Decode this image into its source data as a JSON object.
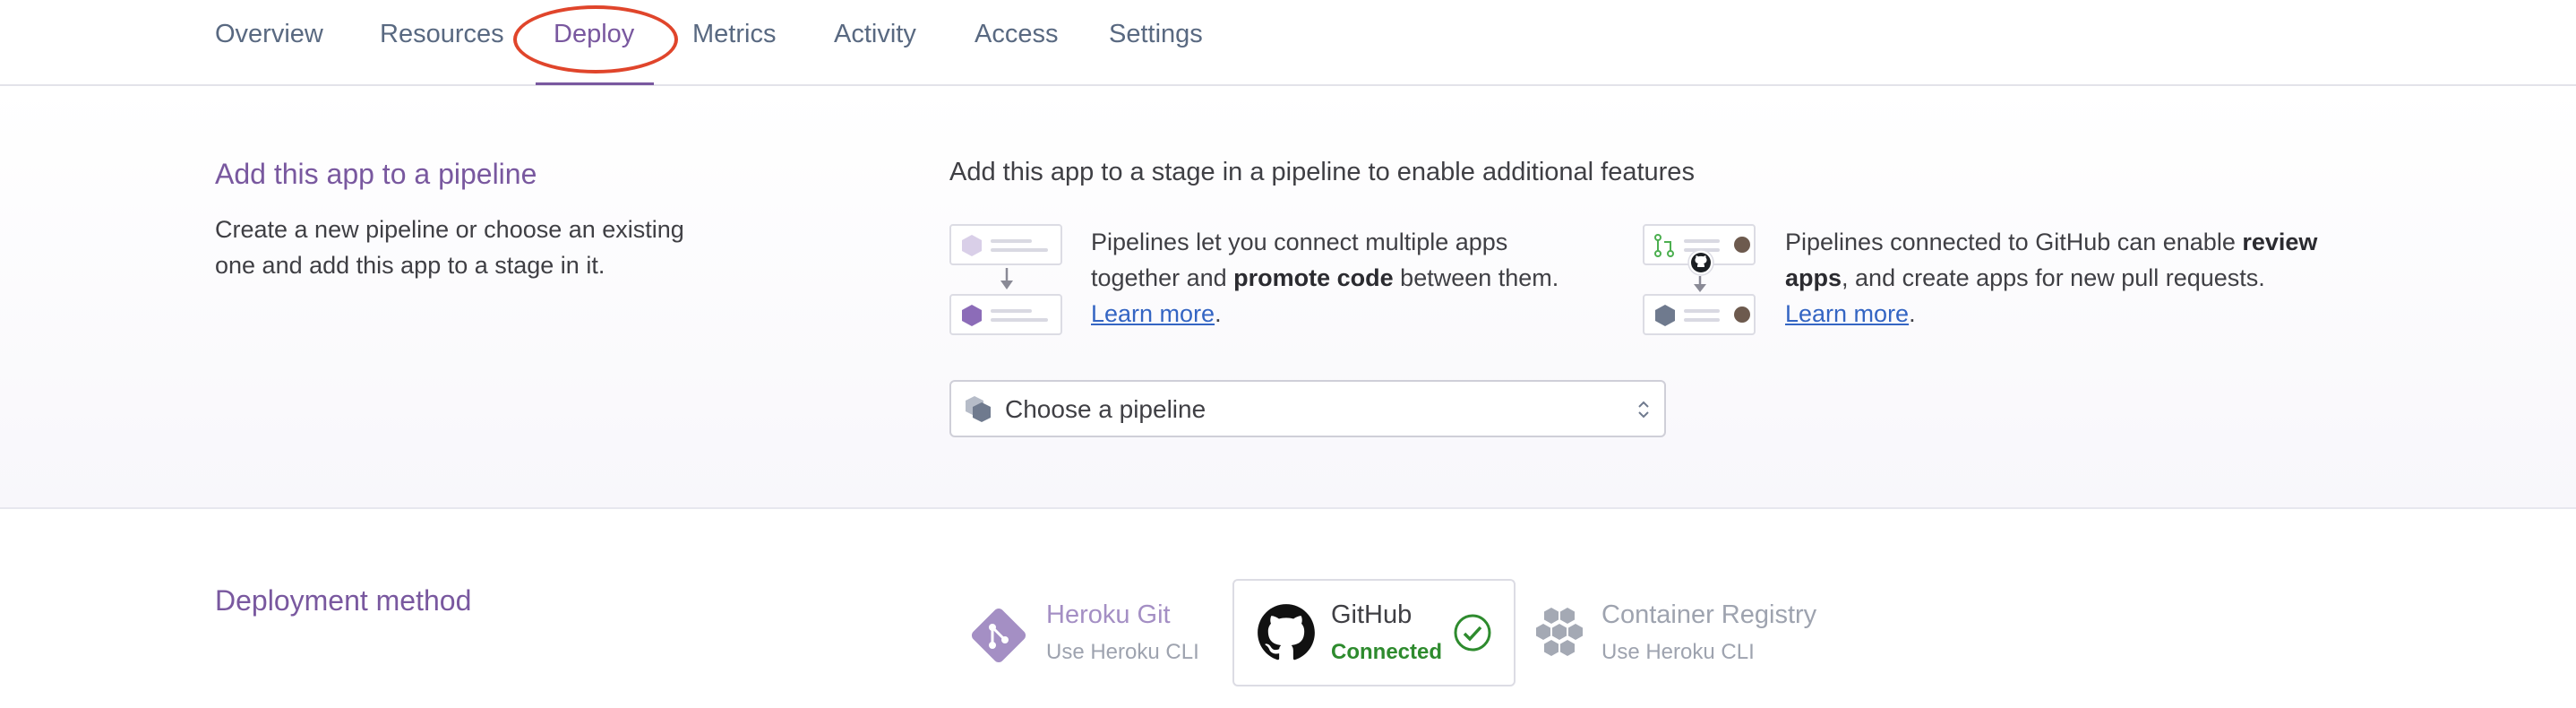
{
  "nav": {
    "tabs": [
      {
        "label": "Overview"
      },
      {
        "label": "Resources"
      },
      {
        "label": "Deploy",
        "active": true
      },
      {
        "label": "Metrics"
      },
      {
        "label": "Activity"
      },
      {
        "label": "Access"
      },
      {
        "label": "Settings"
      }
    ]
  },
  "pipeline": {
    "title": "Add this app to a pipeline",
    "description": "Create a new pipeline or choose an existing one and add this app to a stage in it.",
    "heading": "Add this app to a stage in a pipeline to enable additional features",
    "feature1": {
      "text_a": "Pipelines let you connect multiple apps together and ",
      "bold": "promote code",
      "text_b": " between them. ",
      "link": "Learn more",
      "tail": "."
    },
    "feature2": {
      "text_a": "Pipelines connected to GitHub can enable ",
      "bold": "review apps",
      "text_b": ", and create apps for new pull requests. ",
      "link": "Learn more",
      "tail": "."
    },
    "select": {
      "label": "Choose a pipeline"
    }
  },
  "deployment": {
    "title": "Deployment method",
    "methods": [
      {
        "name": "Heroku Git",
        "sub": "Use Heroku CLI",
        "icon": "heroku-git-icon"
      },
      {
        "name": "GitHub",
        "sub": "Connected",
        "icon": "github-icon",
        "status_icon": "check-circle-icon",
        "selected": true
      },
      {
        "name": "Container Registry",
        "sub": "Use Heroku CLI",
        "icon": "container-registry-icon"
      }
    ]
  },
  "colors": {
    "accent": "#79589f",
    "link": "#3465c3",
    "connected": "#2e8b2e",
    "annotation": "#e0452b"
  }
}
